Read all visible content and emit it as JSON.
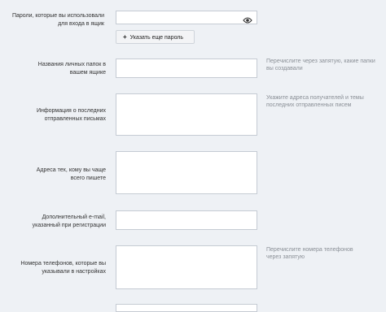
{
  "form": {
    "passwords": {
      "label": "Пароли, которые вы использовали для входа в ящик",
      "add_button_label": "Указать еще пароль"
    },
    "folders": {
      "label": "Названия личных папок в вашем ящике",
      "hint": "Перечислите через запятую, какие папки вы создавали"
    },
    "recent_emails": {
      "label": "Информация о последних отправленных письмах",
      "hint": "Укажите адреса получателей и темы последних отправленных писем"
    },
    "frequent_addresses": {
      "label": "Адреса тех, кому вы чаще всего пишете"
    },
    "extra_email": {
      "label": "Дополнительный e-mail, указанный при регистрации"
    },
    "phones": {
      "label": "Номера телефонов, которые вы указывали в настройках",
      "hint": "Перечислите номера телефонов через запятую"
    }
  },
  "icons": {
    "password_toggle": "eye-icon",
    "add": "plus-icon"
  }
}
